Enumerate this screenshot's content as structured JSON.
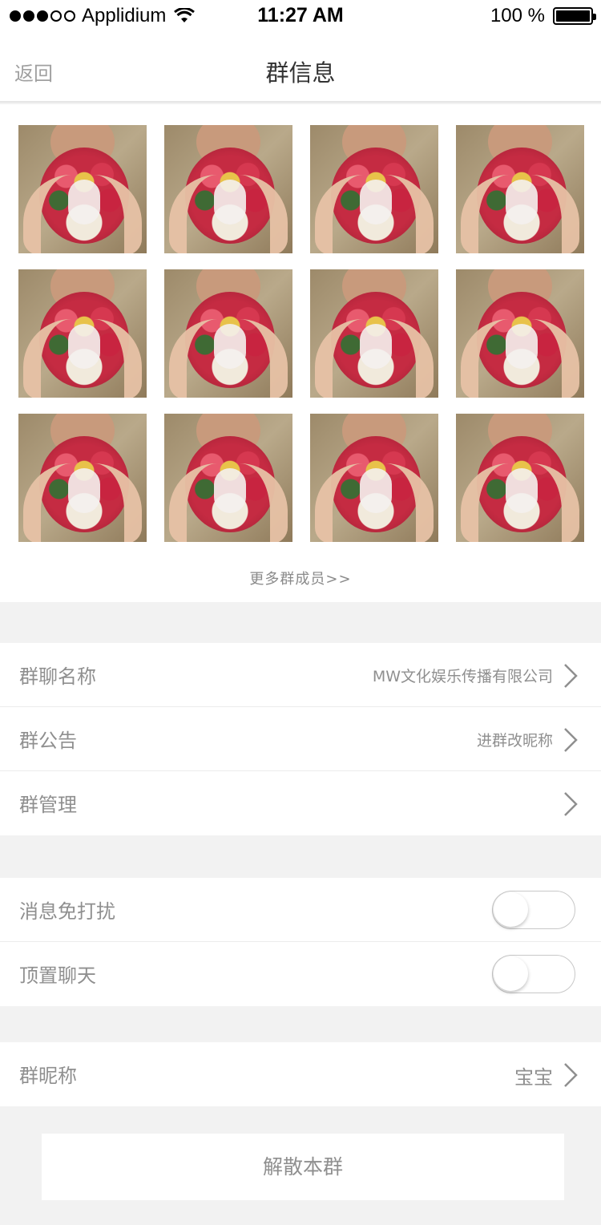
{
  "status_bar": {
    "carrier": "Applidium",
    "time": "11:27 AM",
    "battery": "100 %"
  },
  "nav": {
    "back_label": "返回",
    "title": "群信息"
  },
  "members": {
    "more_label": "更多群成员>>",
    "avatars": [
      {
        "icon": "member-avatar-photo"
      },
      {
        "icon": "member-avatar-photo"
      },
      {
        "icon": "member-avatar-photo"
      },
      {
        "icon": "member-avatar-photo"
      },
      {
        "icon": "member-avatar-photo"
      },
      {
        "icon": "member-avatar-photo"
      },
      {
        "icon": "member-avatar-photo"
      },
      {
        "icon": "member-avatar-photo"
      },
      {
        "icon": "member-avatar-photo"
      },
      {
        "icon": "member-avatar-photo"
      },
      {
        "icon": "member-avatar-photo"
      },
      {
        "icon": "member-avatar-photo"
      }
    ]
  },
  "info_group": {
    "name_label": "群聊名称",
    "name_value": "MW文化娱乐传播有限公司",
    "notice_label": "群公告",
    "notice_value": "进群改昵称",
    "manage_label": "群管理"
  },
  "settings_group": {
    "mute_label": "消息免打扰",
    "mute_on": false,
    "pin_label": "顶置聊天",
    "pin_on": false
  },
  "nickname_group": {
    "label": "群昵称",
    "value": "宝宝"
  },
  "dissolve_label": "解散本群",
  "colors": {
    "background": "#f2f2f2",
    "text_muted": "#8f8f8f",
    "title": "#333333"
  }
}
